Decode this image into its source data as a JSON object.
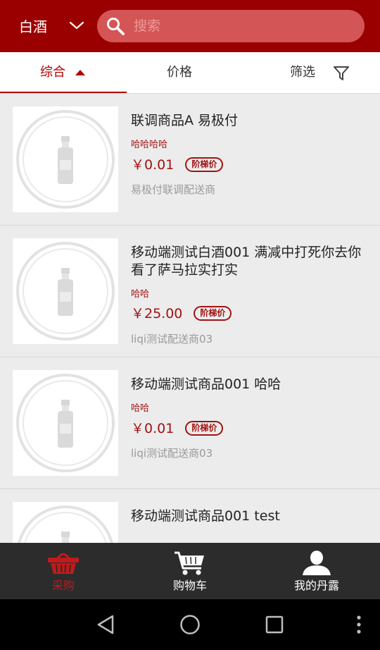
{
  "header": {
    "category_label": "白酒",
    "search_placeholder": "搜索"
  },
  "sort": {
    "tabs": [
      {
        "label": "综合",
        "active": true
      },
      {
        "label": "价格",
        "active": false
      },
      {
        "label": "筛选",
        "active": false
      }
    ]
  },
  "products": [
    {
      "title": "联调商品A 易极付",
      "subtitle": "哈哈哈哈",
      "price": "￥0.01",
      "tag": "阶梯价",
      "vendor": "易极付联调配送商"
    },
    {
      "title": "移动端测试白酒001 满减中打死你去你看了萨马拉实打实",
      "subtitle": "哈哈",
      "price": "￥25.00",
      "tag": "阶梯价",
      "vendor": "liqi测试配送商03"
    },
    {
      "title": "移动端测试商品001 哈哈",
      "subtitle": "哈哈",
      "price": "￥0.01",
      "tag": "阶梯价",
      "vendor": "liqi测试配送商03"
    },
    {
      "title": "移动端测试商品001 test",
      "subtitle": "",
      "price": "",
      "tag": "",
      "vendor": ""
    }
  ],
  "tabbar": {
    "items": [
      {
        "label": "采购",
        "icon": "basket-icon",
        "active": true
      },
      {
        "label": "购物车",
        "icon": "cart-icon",
        "active": false
      },
      {
        "label": "我的丹露",
        "icon": "user-icon",
        "active": false
      }
    ]
  },
  "colors": {
    "brand": "#9b0000",
    "accent": "#a11212",
    "tabbar_bg": "#2c2c2c"
  }
}
